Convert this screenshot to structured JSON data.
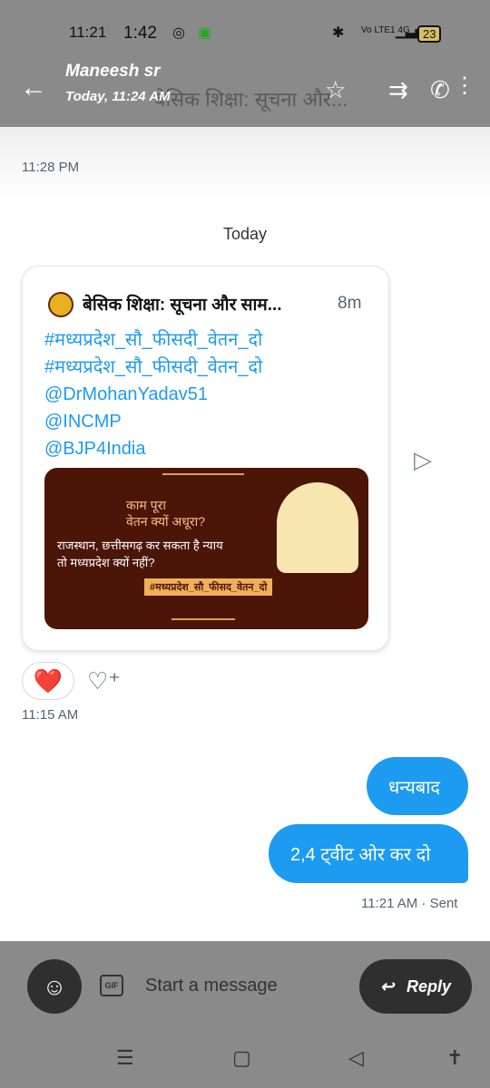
{
  "status": {
    "time_overlay": "11:21",
    "time": "1:42",
    "network": "Vo LTE1 4G",
    "battery": "23"
  },
  "header": {
    "name": "Maneesh sr",
    "subtitle": "Today, 11:24 AM",
    "ghost_title": "बेसिक शिक्षा: सूचना और..."
  },
  "chat": {
    "prev_time": "11:28 PM",
    "day_divider": "Today",
    "card": {
      "title": "बेसिक शिक्षा: सूचना और साम...",
      "age": "8m",
      "lines": [
        "#मध्यप्रदेश_सौ_फीसदी_वेतन_दो",
        "#मध्यप्रदेश_सौ_फीसदी_वेतन_दो",
        "@DrMohanYadav51",
        "@INCMP",
        "@BJP4India"
      ],
      "poster": {
        "line1": "काम पूरा\nवेतन क्यों अधूरा?",
        "line2": "राजस्थान, छत्तीसगढ़ कर सकता है न्याय\nतो मध्यप्रदेश क्यों नहीं?",
        "tag": "#मध्यप्रदेश_सौ_फीसद_वेतन_दो"
      }
    },
    "reaction": "❤️",
    "card_time": "11:15 AM",
    "messages": [
      "धन्यबाद",
      "2,4 ट्वीट ओर कर दो"
    ],
    "sent_status": "11:21 AM · Sent"
  },
  "composer": {
    "gif_label": "GIF",
    "placeholder": "Start a message",
    "reply_label": "Reply"
  }
}
